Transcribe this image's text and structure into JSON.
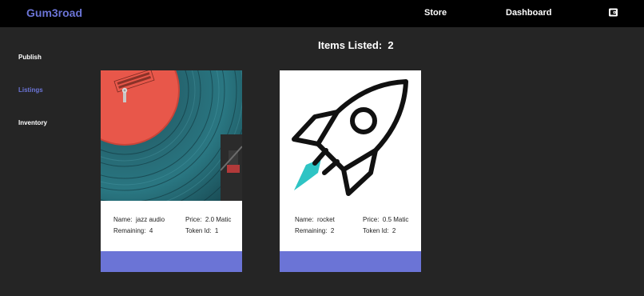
{
  "header": {
    "brand": "Gum3road",
    "nav": [
      {
        "label": "Store"
      },
      {
        "label": "Dashboard"
      }
    ],
    "wallet_icon": "wallet-icon"
  },
  "sidebar": {
    "items": [
      {
        "label": "Publish",
        "active": false
      },
      {
        "label": "Listings",
        "active": true
      },
      {
        "label": "Inventory",
        "active": false
      }
    ]
  },
  "main": {
    "heading_label": "Items Listed:",
    "heading_count": "2"
  },
  "listings": [
    {
      "image": "vinyl-record-photo",
      "name_label": "Name:",
      "name": "jazz audio",
      "price_label": "Price:",
      "price": "2.0 Matic",
      "remaining_label": "Remaining:",
      "remaining": "4",
      "token_label": "Token Id:",
      "token_id": "1"
    },
    {
      "image": "rocket-icon",
      "name_label": "Name:",
      "name": "rocket",
      "price_label": "Price:",
      "price": "0.5 Matic",
      "remaining_label": "Remaining:",
      "remaining": "2",
      "token_label": "Token Id:",
      "token_id": "2"
    }
  ],
  "colors": {
    "accent": "#6b74d6",
    "background": "#252525",
    "topbar": "#000000",
    "card": "#ffffff",
    "rocket_flame": "#2ec4c4"
  }
}
